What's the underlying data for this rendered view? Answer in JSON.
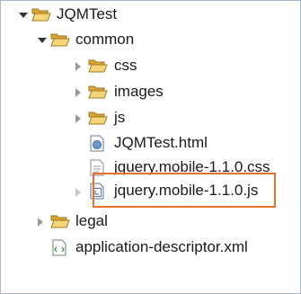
{
  "tree": {
    "items": [
      {
        "label": "JQMTest",
        "type": "folder",
        "expanded": true
      },
      {
        "label": "common",
        "type": "folder",
        "expanded": true
      },
      {
        "label": "css",
        "type": "folder",
        "expanded": false
      },
      {
        "label": "images",
        "type": "folder",
        "expanded": false
      },
      {
        "label": "js",
        "type": "folder",
        "expanded": false
      },
      {
        "label": "JQMTest.html",
        "type": "html-file"
      },
      {
        "label": "jquery.mobile-1.1.0.css",
        "type": "css-file"
      },
      {
        "label": "jquery.mobile-1.1.0.js",
        "type": "js-file"
      },
      {
        "label": "legal",
        "type": "folder",
        "expanded": false
      },
      {
        "label": "application-descriptor.xml",
        "type": "xml-file"
      }
    ],
    "highlight_color": "#e87030",
    "folder_color": "#e8b84a"
  }
}
